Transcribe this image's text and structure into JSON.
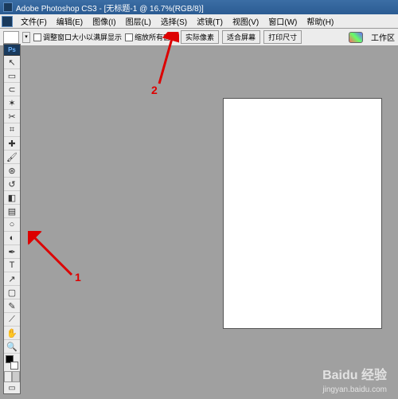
{
  "titlebar": {
    "title": "Adobe Photoshop CS3 - [无标题-1 @ 16.7%(RGB/8)]"
  },
  "menu": {
    "items": [
      "文件(F)",
      "编辑(E)",
      "图像(I)",
      "图层(L)",
      "选择(S)",
      "滤镜(T)",
      "视图(V)",
      "窗口(W)",
      "帮助(H)"
    ]
  },
  "optbar": {
    "cb1": "调整窗口大小以满屏显示",
    "cb2": "缩放所有窗口",
    "btn_actual": "实际像素",
    "btn_fit": "适合屏幕",
    "btn_print": "打印尺寸",
    "right_label": "工作区"
  },
  "toolbox": {
    "head": "Ps",
    "tools": [
      {
        "name": "move-tool",
        "glyph": "↖"
      },
      {
        "name": "marquee-tool",
        "glyph": "▭"
      },
      {
        "name": "lasso-tool",
        "glyph": "⊂"
      },
      {
        "name": "wand-tool",
        "glyph": "✶"
      },
      {
        "name": "crop-tool",
        "glyph": "✂"
      },
      {
        "name": "slice-tool",
        "glyph": "⌗"
      },
      {
        "name": "healing-tool",
        "glyph": "✚"
      },
      {
        "name": "brush-tool",
        "glyph": "🖌"
      },
      {
        "name": "stamp-tool",
        "glyph": "⊛"
      },
      {
        "name": "history-brush",
        "glyph": "↺"
      },
      {
        "name": "eraser-tool",
        "glyph": "◧"
      },
      {
        "name": "gradient-tool",
        "glyph": "▤"
      },
      {
        "name": "blur-tool",
        "glyph": "○"
      },
      {
        "name": "dodge-tool",
        "glyph": "◐"
      },
      {
        "name": "pen-tool",
        "glyph": "✒"
      },
      {
        "name": "type-tool",
        "glyph": "T"
      },
      {
        "name": "path-tool",
        "glyph": "↗"
      },
      {
        "name": "shape-tool",
        "glyph": "▢"
      },
      {
        "name": "notes-tool",
        "glyph": "✎"
      },
      {
        "name": "eyedropper",
        "glyph": "⟋"
      },
      {
        "name": "hand-tool",
        "glyph": "✋"
      },
      {
        "name": "zoom-tool",
        "glyph": "🔍"
      }
    ]
  },
  "annotations": {
    "one": "1",
    "two": "2"
  },
  "watermark": {
    "main": "Baidu 经验",
    "sub": "jingyan.baidu.com"
  }
}
